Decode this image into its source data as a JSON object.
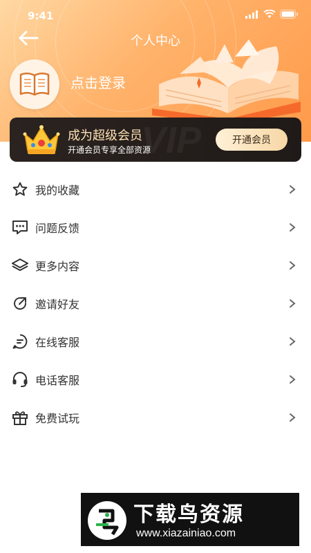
{
  "status_bar": {
    "time": "9:41"
  },
  "header": {
    "title": "个人中心",
    "login_text": "点击登录"
  },
  "vip": {
    "title": "成为超级会员",
    "subtitle": "开通会员专享全部资源",
    "button_label": "开通会员",
    "watermark": "VIP"
  },
  "menu": {
    "items": [
      {
        "label": "我的收藏",
        "icon": "star-icon"
      },
      {
        "label": "问题反馈",
        "icon": "chat-icon"
      },
      {
        "label": "更多内容",
        "icon": "layers-icon"
      },
      {
        "label": "邀请好友",
        "icon": "share-icon"
      },
      {
        "label": "在线客服",
        "icon": "message-icon"
      },
      {
        "label": "电话客服",
        "icon": "headset-icon"
      },
      {
        "label": "免费试玩",
        "icon": "gift-icon"
      }
    ]
  },
  "watermark": {
    "title": "下载鸟资源",
    "url": "www.xiazainiao.com"
  },
  "colors": {
    "header_start": "#ffd8a3",
    "header_end": "#ff9a4a",
    "vip_dark": "#1f1a18",
    "vip_gold": "#ffe2b4"
  }
}
